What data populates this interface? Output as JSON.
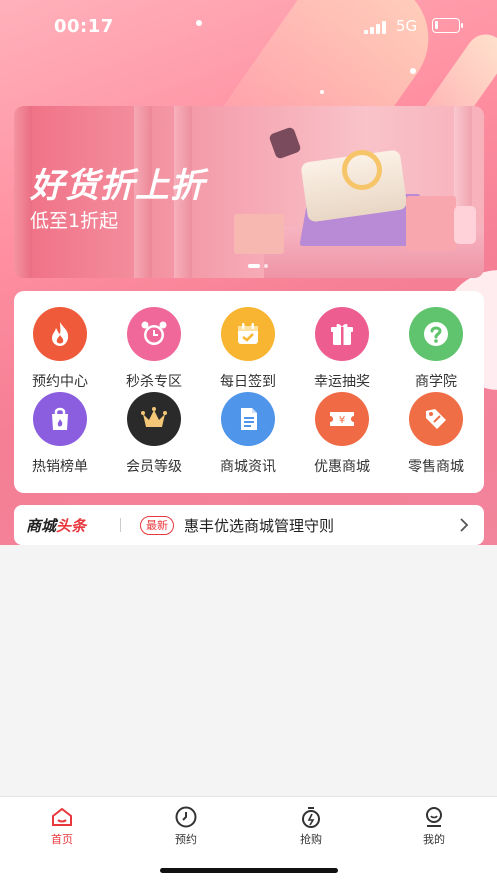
{
  "status_bar": {
    "time": "00:17",
    "network": "5G"
  },
  "banner": {
    "title": "好货折上折",
    "subtitle": "低至1折起",
    "pager_active": 1,
    "pager_count": 2
  },
  "menu": {
    "items": [
      {
        "label": "预约中心",
        "icon": "flame-icon",
        "color": "#ee5a3a"
      },
      {
        "label": "秒杀专区",
        "icon": "alarm-clock-icon",
        "color": "#f0679a"
      },
      {
        "label": "每日签到",
        "icon": "calendar-check-icon",
        "color": "#f7b531"
      },
      {
        "label": "幸运抽奖",
        "icon": "gift-icon",
        "color": "#ee5d8f"
      },
      {
        "label": "商学院",
        "icon": "question-icon",
        "color": "#5fc46d"
      },
      {
        "label": "热销榜单",
        "icon": "shopping-bag-icon",
        "color": "#8b5ee0"
      },
      {
        "label": "会员等级",
        "icon": "crown-icon",
        "color": "#2a2a2a"
      },
      {
        "label": "商城资讯",
        "icon": "document-icon",
        "color": "#4f95ea"
      },
      {
        "label": "优惠商城",
        "icon": "coupon-icon",
        "color": "#ef6a45"
      },
      {
        "label": "零售商城",
        "icon": "price-tag-icon",
        "color": "#f06e45"
      }
    ]
  },
  "news": {
    "brand_black": "商城",
    "brand_red": "头条",
    "badge": "最新",
    "headline": "惠丰优选商城管理守则"
  },
  "tabbar": {
    "items": [
      {
        "label": "首页",
        "icon": "home-icon",
        "active": true
      },
      {
        "label": "预约",
        "icon": "clock-icon",
        "active": false
      },
      {
        "label": "抢购",
        "icon": "stopwatch-icon",
        "active": false
      },
      {
        "label": "我的",
        "icon": "user-icon",
        "active": false
      }
    ],
    "active_color": "#e8383d"
  }
}
